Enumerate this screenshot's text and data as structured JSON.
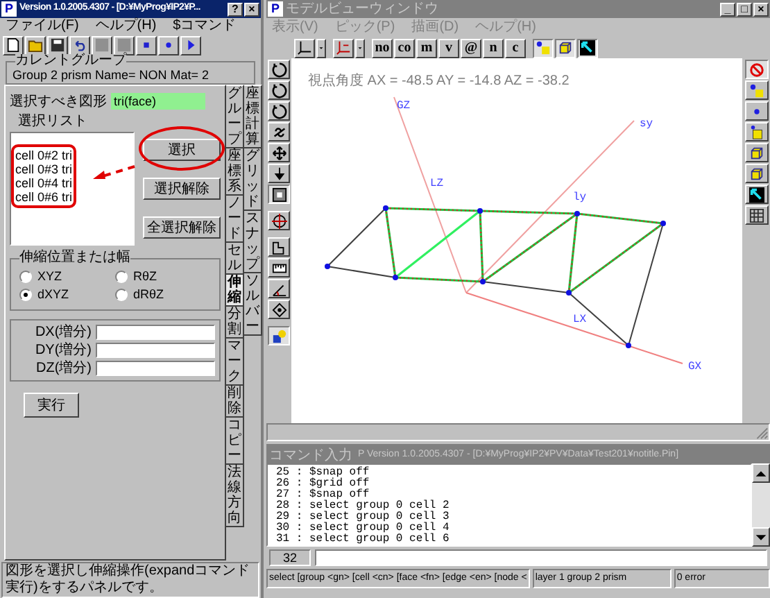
{
  "main_window": {
    "logo": "P",
    "title": "Version 1.0.2005.4307 - [D:¥MyProg¥IP2¥P...",
    "controls": [
      "?",
      "×"
    ],
    "menu": [
      "ファイル(F)",
      "ヘルプ(H)",
      "$コマンド"
    ]
  },
  "current_group": {
    "legend": "カレントグループ",
    "text": "Group 2 prism Name= NON Mat= 2"
  },
  "select_panel": {
    "target_label": "選択すべき図形",
    "target_value": "tri(face)",
    "list_label": "選択リスト",
    "list": [
      "cell 0#2 tri",
      "cell 0#3 tri",
      "cell 0#4 tri",
      "cell 0#6 tri"
    ],
    "list_outlined": true,
    "arrow": true,
    "buttons": [
      {
        "label": "選択",
        "circled": true
      },
      {
        "label": "選択解除",
        "circled": false
      },
      {
        "label": "全選択解除",
        "circled": false
      }
    ]
  },
  "expand_panel": {
    "legend": "伸縮位置または幅",
    "modes": [
      {
        "label": "XYZ",
        "selected": false
      },
      {
        "label": "RθZ",
        "selected": false
      },
      {
        "label": "dXYZ",
        "selected": true
      },
      {
        "label": "dRθZ",
        "selected": false
      }
    ],
    "increments": [
      "DX(増分)",
      "DY(増分)",
      "DZ(増分)"
    ],
    "execute": "実行"
  },
  "tabs_front": [
    {
      "label": "グループ",
      "selected": false
    },
    {
      "label": "座標系",
      "selected": false
    },
    {
      "label": "ノード",
      "selected": false
    },
    {
      "label": "セル",
      "selected": false
    },
    {
      "label": "伸縮",
      "selected": true
    },
    {
      "label": "分割",
      "selected": false
    },
    {
      "label": "マーク",
      "selected": false
    },
    {
      "label": "削除",
      "selected": false
    },
    {
      "label": "コピー",
      "selected": false
    },
    {
      "label": "法線方向",
      "selected": false
    }
  ],
  "tabs_back": [
    {
      "label": "座標計算",
      "selected": false
    },
    {
      "label": "グリッド",
      "selected": false
    },
    {
      "label": "スナップ",
      "selected": false
    },
    {
      "label": "ソルバー",
      "selected": false
    }
  ],
  "hint": "図形を選択し伸縮操作(expandコマンド実行)をするパネルです。",
  "model_view": {
    "logo": "P",
    "title": "モデルビューウィンドウ",
    "controls": [
      "_",
      "□",
      "×"
    ],
    "menu": [
      "表示(V)",
      "ピック(P)",
      "描画(D)",
      "ヘルプ(H)"
    ],
    "text_buttons": [
      "no",
      "co",
      "m",
      "v",
      "@",
      "n",
      "c"
    ],
    "view_angle": "視点角度 AX = -48.5 AY = -14.8 AZ = -38.2",
    "axis_labels": [
      "GZ",
      "sy",
      "LZ",
      "ly",
      "LX",
      "GX"
    ]
  },
  "command_window": {
    "title_label": "コマンド入力",
    "title": "P Version 1.0.2005.4307 - [D:¥MyProg¥IP2¥PV¥Data¥Test201¥notitle.Pin]",
    "log": [
      "25 : $snap off",
      "26 : $grid off",
      "27 : $snap off",
      "28 : select group 0 cell 2",
      "29 : select group 0 cell 3",
      "30 : select group 0 cell 4",
      "31 : select group 0 cell 6"
    ],
    "line_number": "32",
    "status": [
      "select [group <gn> [cell <cn> [face <fn> [edge <en> [node <",
      "layer 1 group 2 prism",
      "0 error"
    ]
  }
}
